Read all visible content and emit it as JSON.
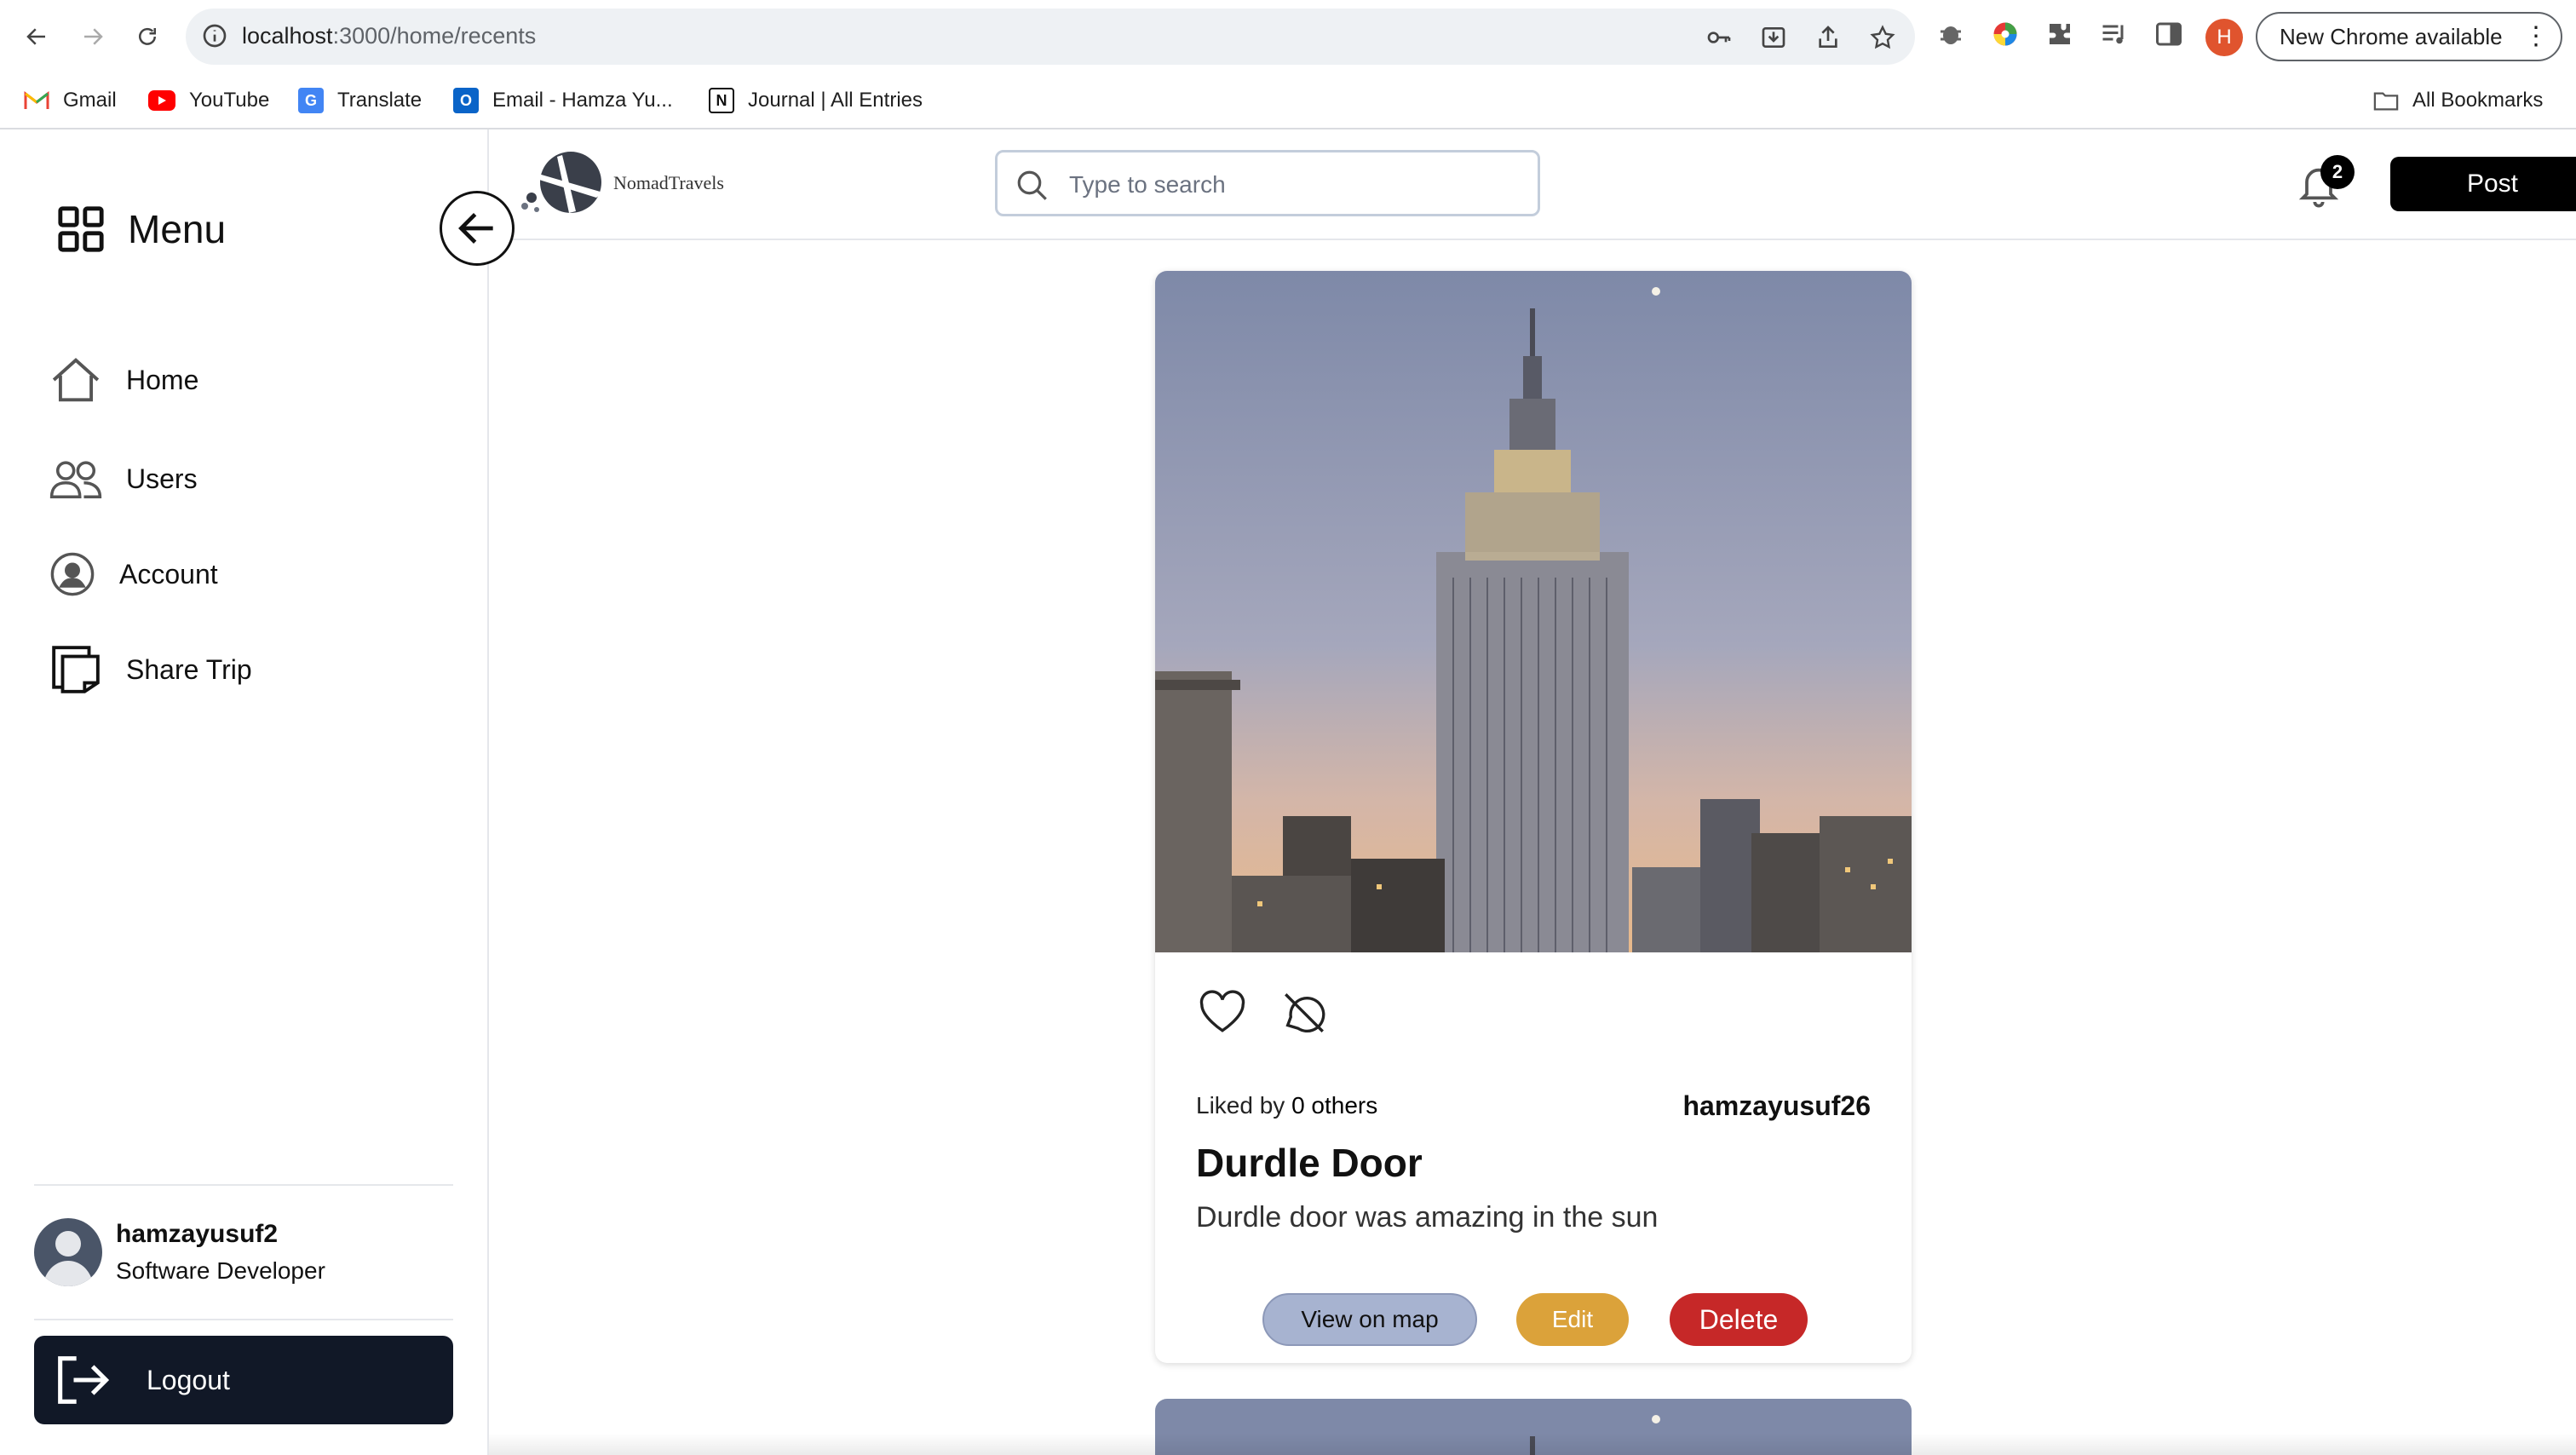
{
  "browser": {
    "url_host": "localhost",
    "url_path": ":3000/home/recents",
    "profile_initial": "H",
    "update_label": "New Chrome available",
    "bookmarks": [
      {
        "label": "Gmail"
      },
      {
        "label": "YouTube"
      },
      {
        "label": "Translate"
      },
      {
        "label": "Email - Hamza Yu..."
      },
      {
        "label": "Journal | All Entries"
      }
    ],
    "all_bookmarks": "All Bookmarks"
  },
  "header": {
    "logo_text": "NomadTravels",
    "search_placeholder": "Type to search",
    "notification_count": "2",
    "post_label": "Post"
  },
  "sidebar": {
    "menu_title": "Menu",
    "items": [
      {
        "label": "Home",
        "icon": "home-icon"
      },
      {
        "label": "Users",
        "icon": "users-icon"
      },
      {
        "label": "Account",
        "icon": "account-icon"
      },
      {
        "label": "Share Trip",
        "icon": "share-trip-icon"
      }
    ],
    "user": {
      "name": "hamzayusuf2",
      "role": "Software Developer"
    },
    "logout_label": "Logout"
  },
  "post": {
    "liked_prefix": "Liked by",
    "liked_count": "0 others",
    "author": "hamzayusuf26",
    "title": "Durdle Door",
    "description": "Durdle door was amazing in the sun",
    "buttons": {
      "map": "View on map",
      "edit": "Edit",
      "delete": "Delete"
    }
  },
  "colors": {
    "accent_dark": "#111827",
    "map_button": "#a7b3d0",
    "edit_button": "#dba23a",
    "delete_button": "#c62828"
  }
}
